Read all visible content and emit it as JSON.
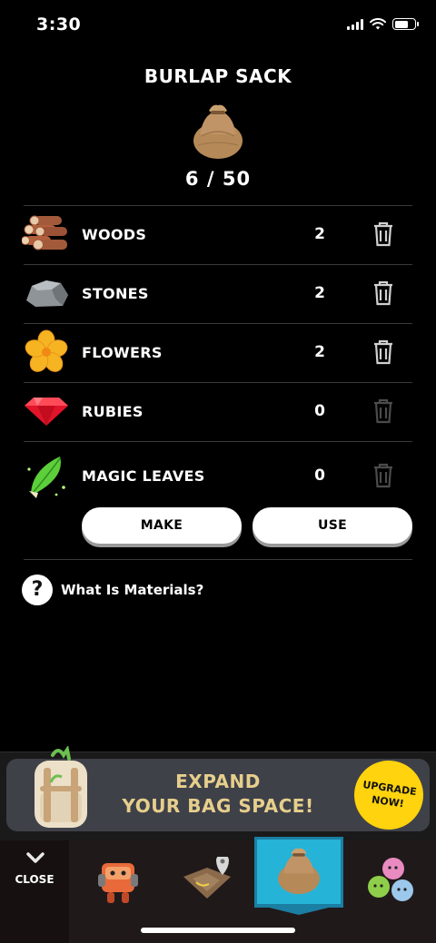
{
  "status": {
    "time": "3:30"
  },
  "header": {
    "title": "BURLAP SACK",
    "capacity": "6 / 50"
  },
  "materials": [
    {
      "name": "WOODS",
      "count": "2",
      "icon": "logs-icon",
      "deletable": true
    },
    {
      "name": "STONES",
      "count": "2",
      "icon": "stone-icon",
      "deletable": true
    },
    {
      "name": "FLOWERS",
      "count": "2",
      "icon": "flower-icon",
      "deletable": true
    },
    {
      "name": "RUBIES",
      "count": "0",
      "icon": "ruby-icon",
      "deletable": false
    },
    {
      "name": "MAGIC LEAVES",
      "count": "0",
      "icon": "magic-leaf-icon",
      "deletable": false
    }
  ],
  "actions": {
    "make_label": "MAKE",
    "use_label": "USE"
  },
  "help": {
    "label": "What Is Materials?"
  },
  "banner": {
    "line1": "EXPAND",
    "line2": "YOUR BAG SPACE!",
    "upgrade_line1": "UPGRADE",
    "upgrade_line2": "NOW!"
  },
  "tabbar": {
    "close_label": "CLOSE",
    "tabs": [
      "character-tab",
      "map-tab",
      "bag-tab",
      "friends-tab"
    ],
    "active_tab": "bag-tab"
  },
  "colors": {
    "background": "#000000",
    "banner_text": "#e6cf8c",
    "upgrade_badge": "#ffd30d",
    "active_tab": "#26b3d8"
  }
}
